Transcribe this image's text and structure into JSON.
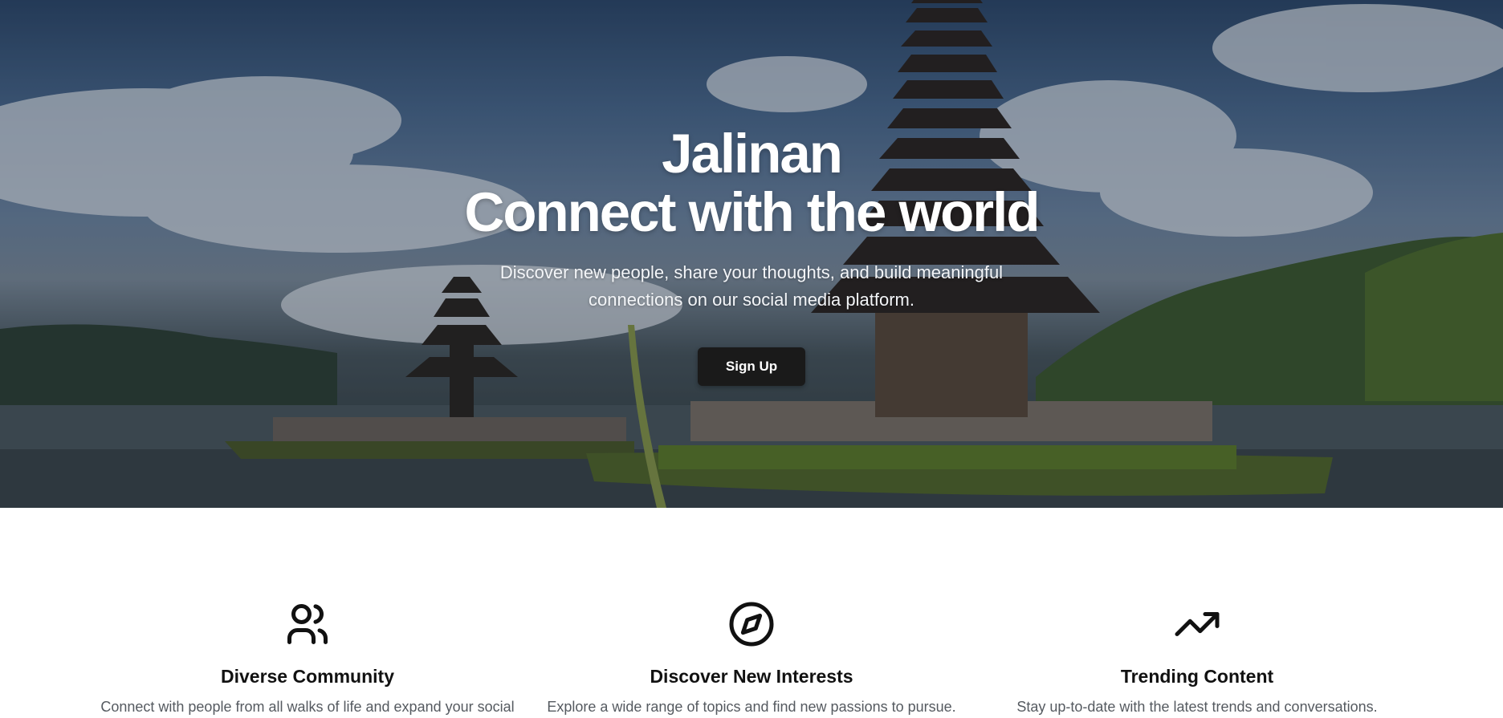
{
  "hero": {
    "title_line1": "Jalinan",
    "title_line2": "Connect with the world",
    "subtitle": "Discover new people, share your thoughts, and build meaningful connections on our social media platform.",
    "signup_label": "Sign Up",
    "background_image": "bali-lake-temple"
  },
  "features": [
    {
      "icon": "users-icon",
      "title": "Diverse Community",
      "description": "Connect with people from all walks of life and expand your social"
    },
    {
      "icon": "compass-icon",
      "title": "Discover New Interests",
      "description": "Explore a wide range of topics and find new passions to pursue."
    },
    {
      "icon": "trending-up-icon",
      "title": "Trending Content",
      "description": "Stay up-to-date with the latest trends and conversations."
    }
  ],
  "colors": {
    "button_bg": "#1a1a1a",
    "text_primary": "#111111",
    "text_muted": "#555a60"
  }
}
